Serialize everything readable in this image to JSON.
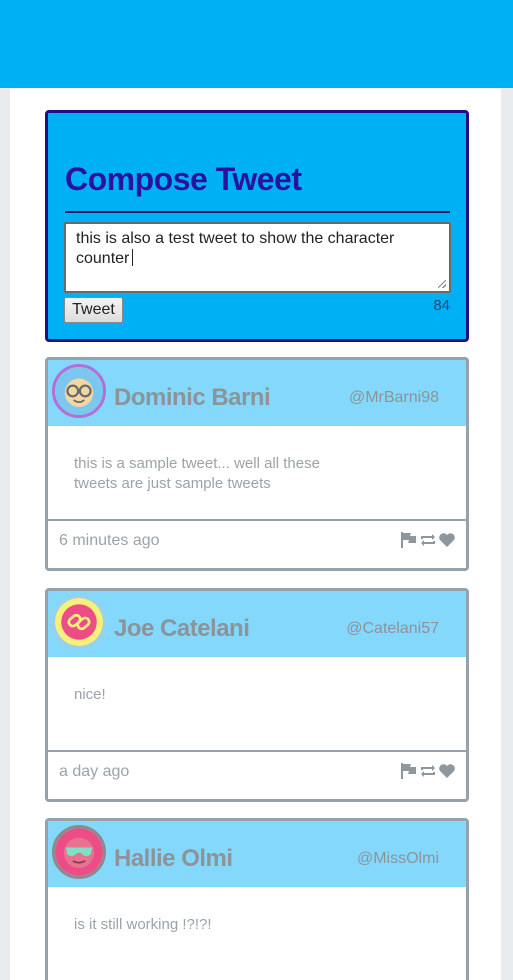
{
  "compose": {
    "title": "Compose Tweet",
    "text": "this is also a test tweet to show the character counter",
    "button_label": "Tweet",
    "char_count": "84"
  },
  "tweets": [
    {
      "name": "Dominic Barni",
      "handle": "@MrBarni98",
      "body": "this is a sample tweet... well all these tweets are just sample tweets",
      "time": "6 minutes ago",
      "avatar_ring": "#b36fd6",
      "avatar_bg": "#7cc7f0"
    },
    {
      "name": "Joe Catelani",
      "handle": "@Catelani57",
      "body": "nice!",
      "time": "a day ago",
      "avatar_ring": "#f8f07a",
      "avatar_bg": "#ec4d86"
    },
    {
      "name": "Hallie Olmi",
      "handle": "@MissOlmi",
      "body": "is it still working !?!?!",
      "time": "",
      "avatar_ring": "#8b8b8b",
      "avatar_bg": "#ec4d86"
    }
  ],
  "icons": {
    "flag": "flag-icon",
    "retweet": "retweet-icon",
    "like": "heart-icon"
  },
  "colors": {
    "header": "#00b0f5",
    "compose_border": "#1f0f80",
    "compose_title": "#2a11a0",
    "card_head": "#83d8fb",
    "card_border": "#96a2ab"
  }
}
